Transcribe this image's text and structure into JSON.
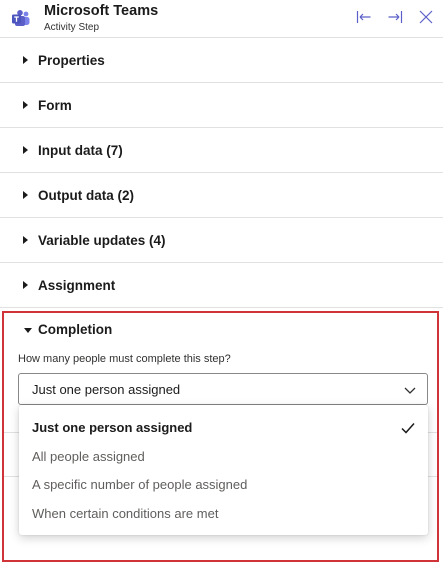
{
  "header": {
    "title": "Microsoft Teams",
    "subtitle": "Activity Step",
    "icons": [
      "teams-logo-icon",
      "collapse-left-icon",
      "expand-right-icon",
      "close-icon"
    ],
    "brand_color": "#5b5fc7"
  },
  "sections": [
    {
      "label": "Properties"
    },
    {
      "label": "Form"
    },
    {
      "label": "Input data (7)"
    },
    {
      "label": "Output data (2)"
    },
    {
      "label": "Variable updates (4)"
    },
    {
      "label": "Assignment"
    }
  ],
  "completion": {
    "label": "Completion",
    "question": "How many people must complete this step?",
    "selected_value": "Just one person assigned",
    "options": [
      {
        "label": "Just one person assigned",
        "selected": true
      },
      {
        "label": "All people assigned",
        "selected": false
      },
      {
        "label": "A specific number of people assigned",
        "selected": false
      },
      {
        "label": "When certain conditions are met",
        "selected": false
      }
    ],
    "highlight_color": "#d13438"
  }
}
